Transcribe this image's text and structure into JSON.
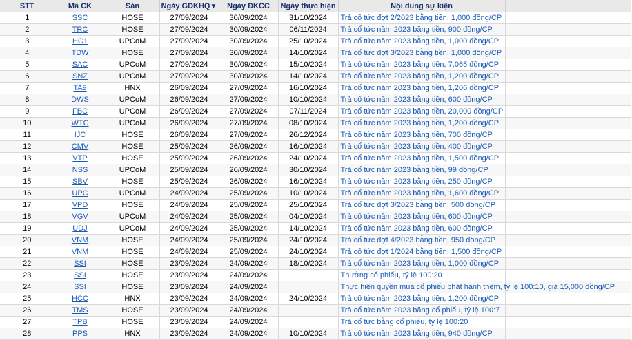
{
  "headers": {
    "stt": "STT",
    "symbol": "Mã CK",
    "exchange": "Sàn",
    "ex_date": "Ngày GDKHQ",
    "ex_date_sort": "▼",
    "record_date": "Ngày ĐKCC",
    "exec_date": "Ngày thực hiện",
    "content": "Nội dung sự kiện"
  },
  "rows": [
    {
      "stt": "1",
      "symbol": "SSC",
      "exchange": "HOSE",
      "ex_date": "27/09/2024",
      "record_date": "30/09/2024",
      "exec_date": "31/10/2024",
      "content": "Trả cổ tức đợt 2/2023 bằng tiền, 1,000 đồng/CP"
    },
    {
      "stt": "2",
      "symbol": "TRC",
      "exchange": "HOSE",
      "ex_date": "27/09/2024",
      "record_date": "30/09/2024",
      "exec_date": "06/11/2024",
      "content": "Trả cổ tức năm 2023 bằng tiền, 900 đồng/CP"
    },
    {
      "stt": "3",
      "symbol": "HC1",
      "exchange": "UPCoM",
      "ex_date": "27/09/2024",
      "record_date": "30/09/2024",
      "exec_date": "25/10/2024",
      "content": "Trả cổ tức năm 2023 bằng tiền, 1,000 đồng/CP"
    },
    {
      "stt": "4",
      "symbol": "TDW",
      "exchange": "HOSE",
      "ex_date": "27/09/2024",
      "record_date": "30/09/2024",
      "exec_date": "14/10/2024",
      "content": "Trả cổ tức đợt 3/2023 bằng tiền, 1,000 đồng/CP"
    },
    {
      "stt": "5",
      "symbol": "SAC",
      "exchange": "UPCoM",
      "ex_date": "27/09/2024",
      "record_date": "30/09/2024",
      "exec_date": "15/10/2024",
      "content": "Trả cổ tức năm 2023 bằng tiền, 7,065 đồng/CP"
    },
    {
      "stt": "6",
      "symbol": "SNZ",
      "exchange": "UPCoM",
      "ex_date": "27/09/2024",
      "record_date": "30/09/2024",
      "exec_date": "14/10/2024",
      "content": "Trả cổ tức năm 2023 bằng tiền, 1,200 đồng/CP"
    },
    {
      "stt": "7",
      "symbol": "TA9",
      "exchange": "HNX",
      "ex_date": "26/09/2024",
      "record_date": "27/09/2024",
      "exec_date": "16/10/2024",
      "content": "Trả cổ tức năm 2023 bằng tiền, 1,206 đồng/CP"
    },
    {
      "stt": "8",
      "symbol": "DWS",
      "exchange": "UPCoM",
      "ex_date": "26/09/2024",
      "record_date": "27/09/2024",
      "exec_date": "10/10/2024",
      "content": "Trả cổ tức năm 2023 bằng tiền, 600 đồng/CP"
    },
    {
      "stt": "9",
      "symbol": "FBC",
      "exchange": "UPCoM",
      "ex_date": "26/09/2024",
      "record_date": "27/09/2024",
      "exec_date": "07/11/2024",
      "content": "Trả cổ tức năm 2023 bằng tiền, 20,000 đồng/CP"
    },
    {
      "stt": "10",
      "symbol": "WTC",
      "exchange": "UPCoM",
      "ex_date": "26/09/2024",
      "record_date": "27/09/2024",
      "exec_date": "08/10/2024",
      "content": "Trả cổ tức năm 2023 bằng tiền, 1,200 đồng/CP"
    },
    {
      "stt": "11",
      "symbol": "IJC",
      "exchange": "HOSE",
      "ex_date": "26/09/2024",
      "record_date": "27/09/2024",
      "exec_date": "26/12/2024",
      "content": "Trả cổ tức năm 2023 bằng tiền, 700 đồng/CP"
    },
    {
      "stt": "12",
      "symbol": "CMV",
      "exchange": "HOSE",
      "ex_date": "25/09/2024",
      "record_date": "26/09/2024",
      "exec_date": "16/10/2024",
      "content": "Trả cổ tức năm 2023 bằng tiền, 400 đồng/CP"
    },
    {
      "stt": "13",
      "symbol": "VTP",
      "exchange": "HOSE",
      "ex_date": "25/09/2024",
      "record_date": "26/09/2024",
      "exec_date": "24/10/2024",
      "content": "Trả cổ tức năm 2023 bằng tiền, 1,500 đồng/CP"
    },
    {
      "stt": "14",
      "symbol": "NSS",
      "exchange": "UPCoM",
      "ex_date": "25/09/2024",
      "record_date": "26/09/2024",
      "exec_date": "30/10/2024",
      "content": "Trả cổ tức năm 2023 bằng tiền, 99 đồng/CP"
    },
    {
      "stt": "15",
      "symbol": "SBV",
      "exchange": "HOSE",
      "ex_date": "25/09/2024",
      "record_date": "26/09/2024",
      "exec_date": "16/10/2024",
      "content": "Trả cổ tức năm 2023 bằng tiền, 250 đồng/CP"
    },
    {
      "stt": "16",
      "symbol": "UPC",
      "exchange": "UPCoM",
      "ex_date": "24/09/2024",
      "record_date": "25/09/2024",
      "exec_date": "10/10/2024",
      "content": "Trả cổ tức năm 2023 bằng tiền, 1,600 đồng/CP"
    },
    {
      "stt": "17",
      "symbol": "VPD",
      "exchange": "HOSE",
      "ex_date": "24/09/2024",
      "record_date": "25/09/2024",
      "exec_date": "25/10/2024",
      "content": "Trả cổ tức đợt 3/2023 bằng tiền, 500 đồng/CP"
    },
    {
      "stt": "18",
      "symbol": "VGV",
      "exchange": "UPCoM",
      "ex_date": "24/09/2024",
      "record_date": "25/09/2024",
      "exec_date": "04/10/2024",
      "content": "Trả cổ tức năm 2023 bằng tiền, 600 đồng/CP"
    },
    {
      "stt": "19",
      "symbol": "UDJ",
      "exchange": "UPCoM",
      "ex_date": "24/09/2024",
      "record_date": "25/09/2024",
      "exec_date": "14/10/2024",
      "content": "Trả cổ tức năm 2023 bằng tiền, 600 đồng/CP"
    },
    {
      "stt": "20",
      "symbol": "VNM",
      "exchange": "HOSE",
      "ex_date": "24/09/2024",
      "record_date": "25/09/2024",
      "exec_date": "24/10/2024",
      "content": "Trả cổ tức đợt 4/2023 bằng tiền, 950 đồng/CP"
    },
    {
      "stt": "21",
      "symbol": "VNM",
      "exchange": "HOSE",
      "ex_date": "24/09/2024",
      "record_date": "25/09/2024",
      "exec_date": "24/10/2024",
      "content": "Trả cổ tức đợt 1/2024 bằng tiền, 1,500 đồng/CP"
    },
    {
      "stt": "22",
      "symbol": "SSI",
      "exchange": "HOSE",
      "ex_date": "23/09/2024",
      "record_date": "24/09/2024",
      "exec_date": "18/10/2024",
      "content": "Trả cổ tức năm 2023 bằng tiền, 1,000 đồng/CP"
    },
    {
      "stt": "23",
      "symbol": "SSI",
      "exchange": "HOSE",
      "ex_date": "23/09/2024",
      "record_date": "24/09/2024",
      "exec_date": "",
      "content": "Thưởng cổ phiếu, tỷ lệ 100:20"
    },
    {
      "stt": "24",
      "symbol": "SSI",
      "exchange": "HOSE",
      "ex_date": "23/09/2024",
      "record_date": "24/09/2024",
      "exec_date": "",
      "content": "Thực hiện quyền mua cổ phiếu phát hành thêm, tỷ lệ 100:10, giá 15,000 đồng/CP"
    },
    {
      "stt": "25",
      "symbol": "HCC",
      "exchange": "HNX",
      "ex_date": "23/09/2024",
      "record_date": "24/09/2024",
      "exec_date": "24/10/2024",
      "content": "Trả cổ tức năm 2023 bằng tiền, 1,200 đồng/CP"
    },
    {
      "stt": "26",
      "symbol": "TMS",
      "exchange": "HOSE",
      "ex_date": "23/09/2024",
      "record_date": "24/09/2024",
      "exec_date": "",
      "content": "Trả cổ tức năm 2023 bằng cổ phiếu, tỷ lệ 100:7"
    },
    {
      "stt": "27",
      "symbol": "TPB",
      "exchange": "HOSE",
      "ex_date": "23/09/2024",
      "record_date": "24/09/2024",
      "exec_date": "",
      "content": "Trả cổ tức bằng cổ phiếu, tỷ lệ 100:20"
    },
    {
      "stt": "28",
      "symbol": "PPS",
      "exchange": "HNX",
      "ex_date": "23/09/2024",
      "record_date": "24/09/2024",
      "exec_date": "10/10/2024",
      "content": "Trả cổ tức năm 2023 bằng tiền, 940 đồng/CP"
    }
  ]
}
